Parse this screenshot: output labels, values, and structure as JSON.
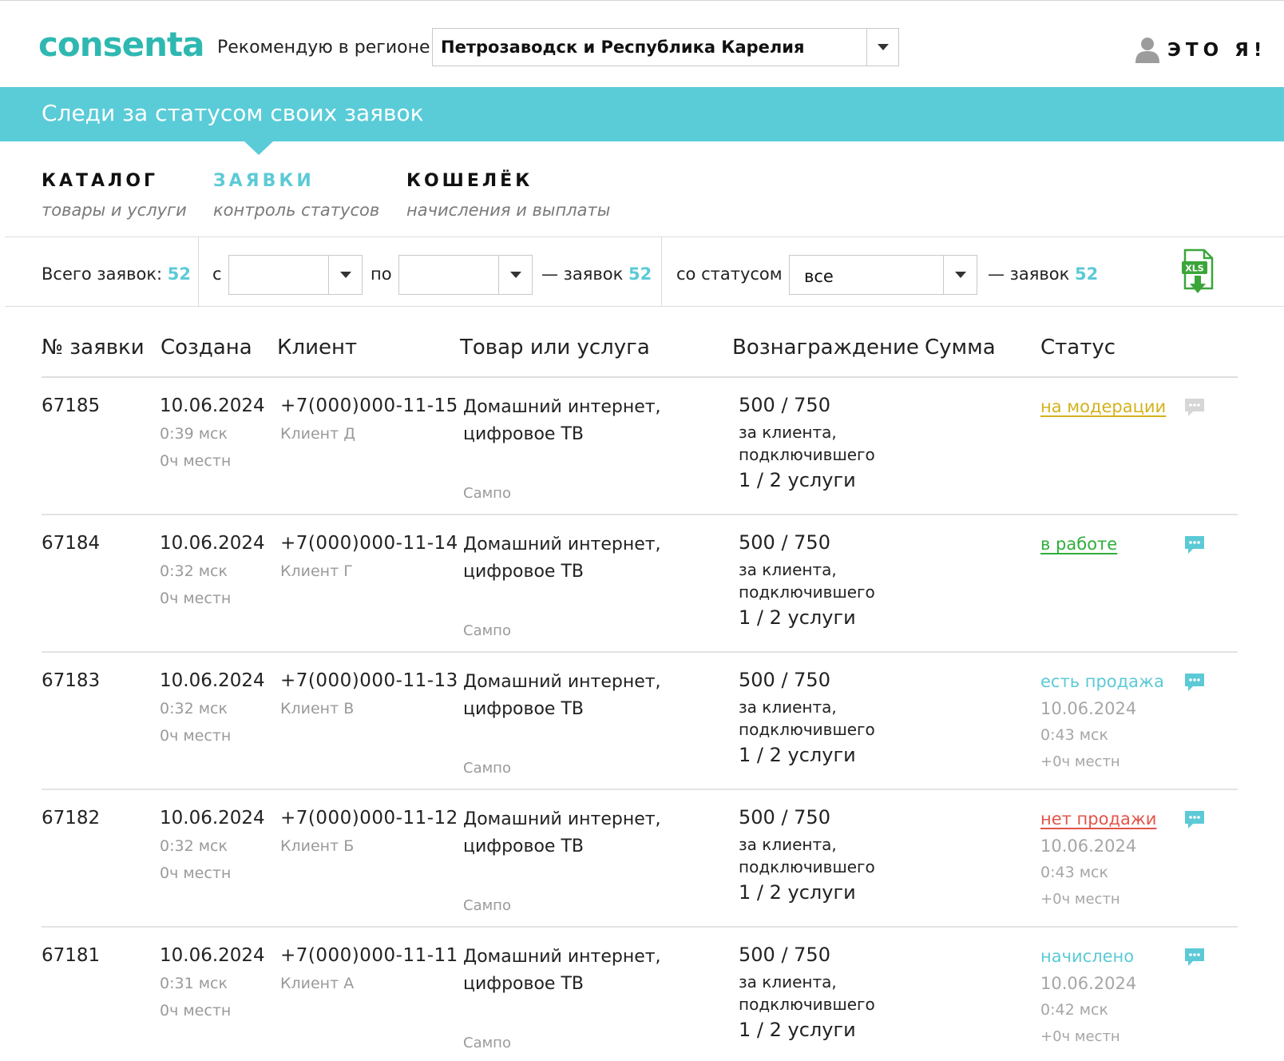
{
  "header": {
    "logo": "consenta",
    "region_label": "Рекомендую в регионе:",
    "region_value": "Петрозаводск и Республика Карелия",
    "user_label": "ЭТО Я!"
  },
  "banner": {
    "text": "Следи за статусом своих заявок"
  },
  "nav": [
    {
      "title": "КАТАЛОГ",
      "subtitle": "товары и услуги"
    },
    {
      "title": "ЗАЯВКИ",
      "subtitle": "контроль статусов",
      "active": true
    },
    {
      "title": "КОШЕЛЁК",
      "subtitle": "начисления и выплаты"
    }
  ],
  "filters": {
    "total_label": "Всего заявок:",
    "total_value": "52",
    "from_label": "с",
    "to_label": "по",
    "date_from": "",
    "date_to": "",
    "count_label": "— заявок",
    "count_value": "52",
    "status_label": "со статусом",
    "status_value": "все",
    "status_count_label": "— заявок",
    "status_count_value": "52",
    "export_icon": "xls-download-icon"
  },
  "table": {
    "columns": [
      "№ заявки",
      "Создана",
      "Клиент",
      "Товар или услуга",
      "Вознаграждение",
      "Сумма",
      "Статус"
    ],
    "rows": [
      {
        "id": "67185",
        "date": "10.06.2024",
        "time": "0:39 мск",
        "tz": "0ч местн",
        "phone": "+7(000)000-11-15",
        "client": "Клиент Д",
        "product_line1": "Домашний интернет,",
        "product_line2": "цифровое ТВ",
        "provider": "Сампо",
        "reward": "500 / 750",
        "reward_desc1": "за клиента,",
        "reward_desc2": "подключившего",
        "reward_qty": "1 / 2 услуги",
        "sum": "",
        "status": "на модерации",
        "status_color": "#d4b21c",
        "status_underline": true,
        "status_date": "",
        "status_time": "",
        "status_tz": "",
        "chat_active": false
      },
      {
        "id": "67184",
        "date": "10.06.2024",
        "time": "0:32 мск",
        "tz": "0ч местн",
        "phone": "+7(000)000-11-14",
        "client": "Клиент Г",
        "product_line1": "Домашний интернет,",
        "product_line2": "цифровое ТВ",
        "provider": "Сампо",
        "reward": "500 / 750",
        "reward_desc1": "за клиента,",
        "reward_desc2": "подключившего",
        "reward_qty": "1 / 2 услуги",
        "sum": "",
        "status": "в работе",
        "status_color": "#2fae3a",
        "status_underline": true,
        "status_date": "",
        "status_time": "",
        "status_tz": "",
        "chat_active": true
      },
      {
        "id": "67183",
        "date": "10.06.2024",
        "time": "0:32 мск",
        "tz": "0ч местн",
        "phone": "+7(000)000-11-13",
        "client": "Клиент В",
        "product_line1": "Домашний интернет,",
        "product_line2": "цифровое ТВ",
        "provider": "Сампо",
        "reward": "500 / 750",
        "reward_desc1": "за клиента,",
        "reward_desc2": "подключившего",
        "reward_qty": "1 / 2 услуги",
        "sum": "",
        "status": "есть продажа",
        "status_color": "#5ccad6",
        "status_underline": false,
        "status_date": "10.06.2024",
        "status_time": "0:43 мск",
        "status_tz": "+0ч местн",
        "chat_active": true
      },
      {
        "id": "67182",
        "date": "10.06.2024",
        "time": "0:32 мск",
        "tz": "0ч местн",
        "phone": "+7(000)000-11-12",
        "client": "Клиент Б",
        "product_line1": "Домашний интернет,",
        "product_line2": "цифровое ТВ",
        "provider": "Сампо",
        "reward": "500 / 750",
        "reward_desc1": "за клиента,",
        "reward_desc2": "подключившего",
        "reward_qty": "1 / 2 услуги",
        "sum": "",
        "status": "нет продажи",
        "status_color": "#e2544a",
        "status_underline": true,
        "status_date": "10.06.2024",
        "status_time": "0:43 мск",
        "status_tz": "+0ч местн",
        "chat_active": true
      },
      {
        "id": "67181",
        "date": "10.06.2024",
        "time": "0:31 мск",
        "tz": "0ч местн",
        "phone": "+7(000)000-11-11",
        "client": "Клиент А",
        "product_line1": "Домашний интернет,",
        "product_line2": "цифровое ТВ",
        "provider": "Сампо",
        "reward": "500 / 750",
        "reward_desc1": "за клиента,",
        "reward_desc2": "подключившего",
        "reward_qty": "1 / 2 услуги",
        "sum": "",
        "status": "начислено",
        "status_color": "#5ccad6",
        "status_underline": false,
        "status_date": "10.06.2024",
        "status_time": "0:42 мск",
        "status_tz": "+0ч местн",
        "chat_active": true
      }
    ]
  },
  "colors": {
    "brand": "#2fb8b2",
    "accent": "#5ccad6",
    "chat_active": "#5ccad6",
    "chat_inactive": "#d6d6d6"
  }
}
